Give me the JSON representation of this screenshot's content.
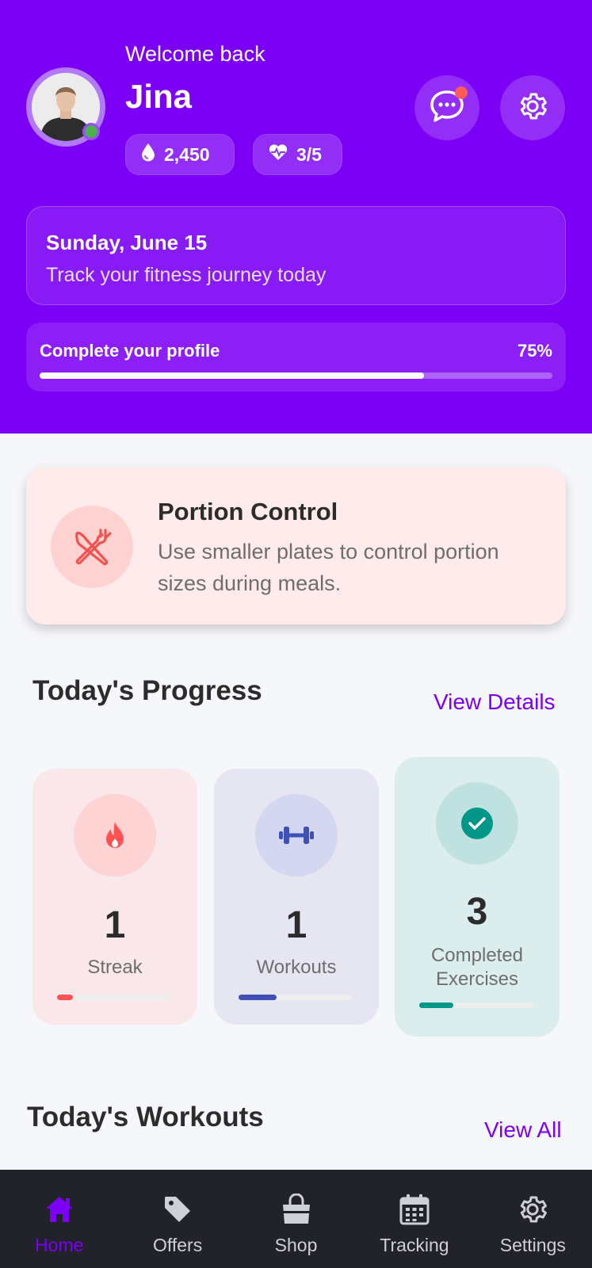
{
  "header": {
    "welcome": "Welcome back",
    "user_name": "Jina",
    "calories_value": "2,450",
    "health_value": "3/5",
    "chat_icon": "chat-bubble-icon",
    "settings_icon": "gear-icon"
  },
  "date_card": {
    "title": "Sunday, June 15",
    "subtitle": "Track your fitness journey today"
  },
  "profile_progress": {
    "label": "Complete your profile",
    "percent_text": "75%",
    "percent": 0.75
  },
  "tip": {
    "title": "Portion Control",
    "body": "Use smaller plates to control portion sizes during meals.",
    "icon": "utensils-crossed-icon"
  },
  "progress_section": {
    "title": "Today's Progress",
    "link": "View Details",
    "stats": [
      {
        "value": "1",
        "label": "Streak",
        "icon": "flame-icon",
        "color": "#ff5252",
        "progress": 0.14
      },
      {
        "value": "1",
        "label": "Workouts",
        "icon": "dumbbell-icon",
        "color": "#3f51b5",
        "progress": 0.33
      },
      {
        "value": "3",
        "label": "Completed Exercises",
        "icon": "check-circle-icon",
        "color": "#009688",
        "progress": 0.3
      }
    ]
  },
  "workouts_section": {
    "title": "Today's Workouts",
    "link": "View All"
  },
  "nav": {
    "items": [
      {
        "label": "Home",
        "icon": "home-icon",
        "active": true
      },
      {
        "label": "Offers",
        "icon": "tag-icon",
        "active": false
      },
      {
        "label": "Shop",
        "icon": "shopping-bag-icon",
        "active": false
      },
      {
        "label": "Tracking",
        "icon": "calendar-icon",
        "active": false
      },
      {
        "label": "Settings",
        "icon": "gear-icon",
        "active": false
      }
    ]
  },
  "colors": {
    "primary": "#7b00f5",
    "nav_background": "#22222a",
    "online_status": "#4caf50",
    "notification": "#ff5b5b"
  }
}
